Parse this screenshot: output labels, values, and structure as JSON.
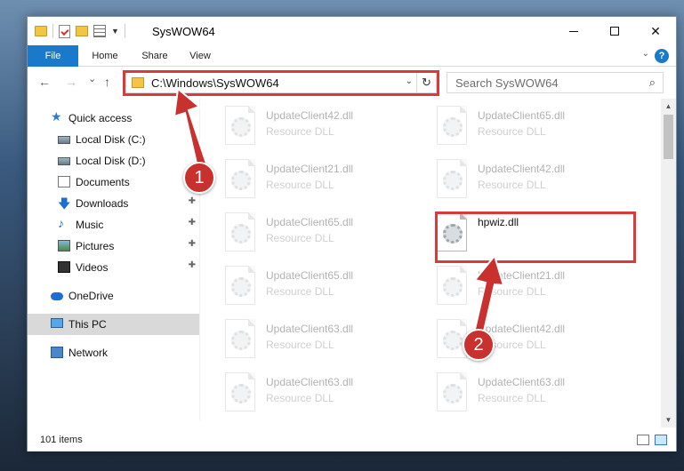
{
  "window": {
    "title": "SysWOW64",
    "minimize_glyph": "",
    "maximize_glyph": "",
    "close_glyph": "✕"
  },
  "ribbon": {
    "tabs": [
      {
        "label": "File"
      },
      {
        "label": "Home"
      },
      {
        "label": "Share"
      },
      {
        "label": "View"
      }
    ],
    "help_glyph": "?"
  },
  "navbar": {
    "back_glyph": "←",
    "forward_glyph": "→",
    "recent_glyph": "⌄",
    "up_glyph": "↑",
    "address": "C:\\Windows\\SysWOW64",
    "dropdown_glyph": "⌄",
    "refresh_glyph": "↻",
    "search_placeholder": "Search SysWOW64",
    "search_glyph": "⌕"
  },
  "sidebar": {
    "items": [
      {
        "label": "Quick access",
        "icon": "star-icon",
        "pinned": false
      },
      {
        "label": "Local Disk (C:)",
        "icon": "drive-icon",
        "pinned": false
      },
      {
        "label": "Local Disk (D:)",
        "icon": "drive-icon",
        "pinned": false
      },
      {
        "label": "Documents",
        "icon": "documents-icon",
        "pinned": false
      },
      {
        "label": "Downloads",
        "icon": "downloads-icon",
        "pinned": true
      },
      {
        "label": "Music",
        "icon": "music-icon",
        "pinned": true
      },
      {
        "label": "Pictures",
        "icon": "pictures-icon",
        "pinned": true
      },
      {
        "label": "Videos",
        "icon": "videos-icon",
        "pinned": true
      },
      {
        "label": "OneDrive",
        "icon": "onedrive-icon",
        "pinned": false
      },
      {
        "label": "This PC",
        "icon": "this-pc-icon",
        "pinned": false,
        "selected": true
      },
      {
        "label": "Network",
        "icon": "network-icon",
        "pinned": false
      }
    ],
    "pin_glyph": "📌"
  },
  "files": [
    {
      "name": "UpdateClient42.dll",
      "type": "Resource DLL",
      "faded": true
    },
    {
      "name": "UpdateClient65.dll",
      "type": "Resource DLL",
      "faded": true
    },
    {
      "name": "UpdateClient21.dll",
      "type": "Resource DLL",
      "faded": true
    },
    {
      "name": "UpdateClient42.dll",
      "type": "Resource DLL",
      "faded": true
    },
    {
      "name": "UpdateClient65.dll",
      "type": "Resource DLL",
      "faded": true
    },
    {
      "name": "hpwiz.dll",
      "type": "",
      "faded": false,
      "highlighted": true
    },
    {
      "name": "UpdateClient65.dll",
      "type": "Resource DLL",
      "faded": true
    },
    {
      "name": "UpdateClient21.dll",
      "type": "Resource DLL",
      "faded": true
    },
    {
      "name": "UpdateClient63.dll",
      "type": "Resource DLL",
      "faded": true
    },
    {
      "name": "UpdateClient42.dll",
      "type": "Resource DLL",
      "faded": true
    },
    {
      "name": "UpdateClient63.dll",
      "type": "Resource DLL",
      "faded": true
    },
    {
      "name": "UpdateClient63.dll",
      "type": "Resource DLL",
      "faded": true
    }
  ],
  "status": {
    "item_count": "101 items"
  },
  "annotations": {
    "step1": "1",
    "step2": "2",
    "highlight_color": "#d93a3a",
    "badge_color": "#c8312e"
  },
  "colors": {
    "accent": "#1979ca",
    "selected_nav": "#d9d9d9"
  }
}
